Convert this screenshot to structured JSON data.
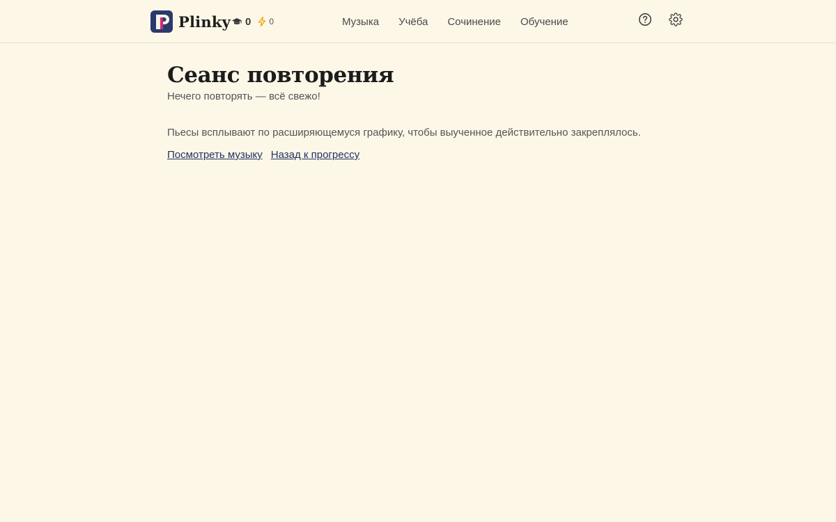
{
  "header": {
    "brand_name": "Plinky",
    "stats": {
      "xp_value": "0",
      "streak_value": "0"
    },
    "nav": [
      {
        "label": "Музыка"
      },
      {
        "label": "Учёба"
      },
      {
        "label": "Сочинение"
      },
      {
        "label": "Обучение"
      }
    ],
    "icons": {
      "help": "help-circle-icon",
      "settings": "gear-icon",
      "xp": "graduation-cap-icon",
      "streak": "lightning-icon"
    }
  },
  "main": {
    "title": "Сеанс повторения",
    "subtitle": "Нечего повторять — всё свежо!",
    "description": "Пьесы всплывают по расширяющемуся графику, чтобы выученное действительно закреплялось.",
    "links": {
      "browse_music": "Посмотреть музыку",
      "back_to_progress": "Назад к прогрессу"
    }
  },
  "colors": {
    "background": "#fdf7e8",
    "logo_bg": "#2b3a6b",
    "logo_accent": "#d4267a",
    "link": "#1f3262"
  }
}
